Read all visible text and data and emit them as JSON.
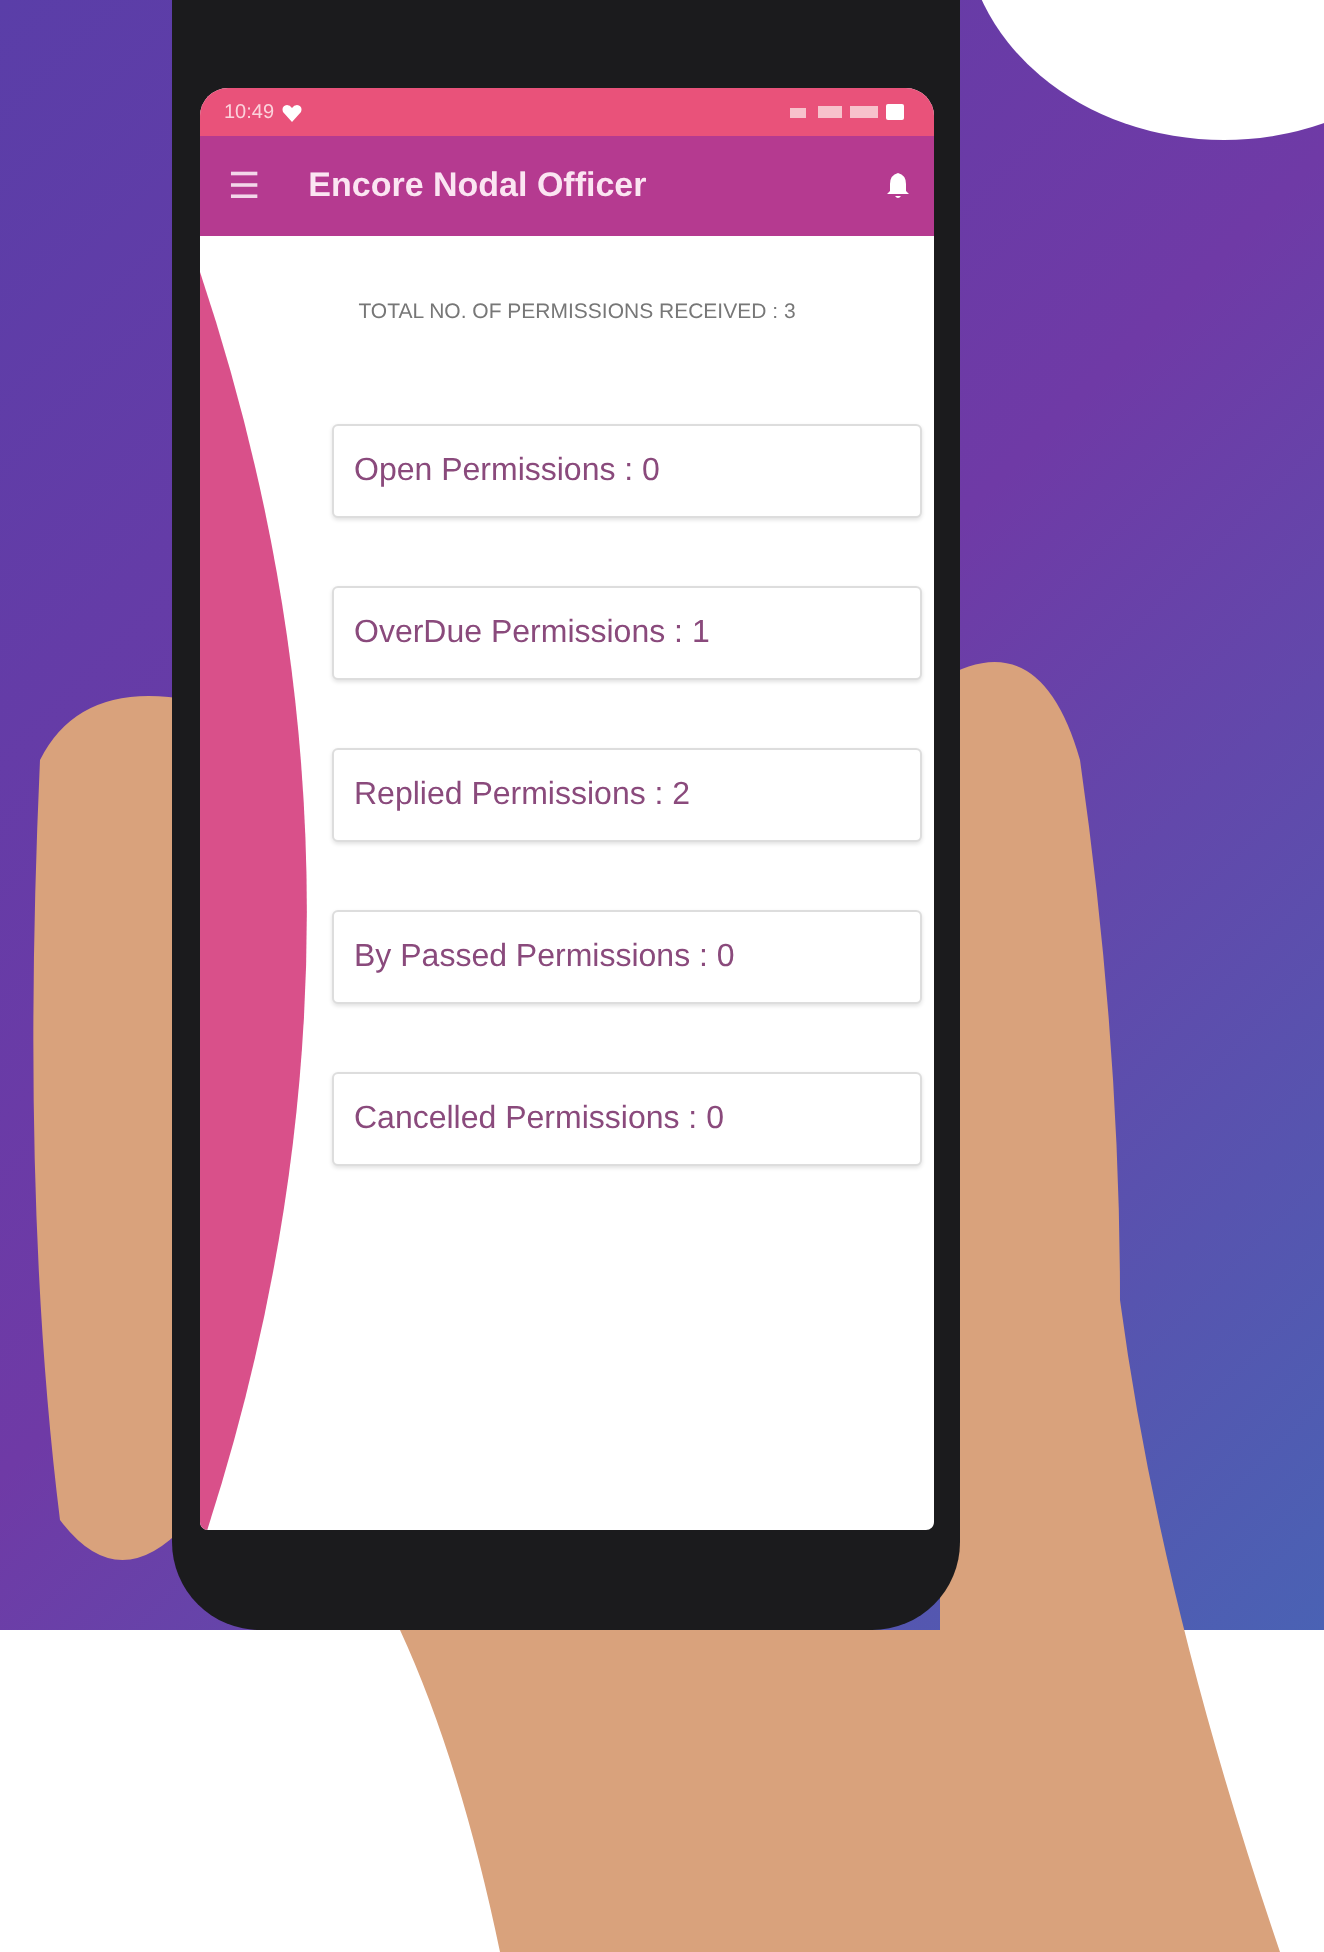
{
  "status_bar": {
    "time": "10:49"
  },
  "app_bar": {
    "menu_icon": "☰",
    "title": "Encore Nodal Officer"
  },
  "summary": "TOTAL NO. OF PERMISSIONS RECEIVED : 3",
  "cards": [
    {
      "label": "Open Permissions : 0"
    },
    {
      "label": "OverDue Permissions : 1"
    },
    {
      "label": "Replied Permissions : 2"
    },
    {
      "label": "By Passed Permissions : 0"
    },
    {
      "label": "Cancelled Permissions : 0"
    }
  ]
}
